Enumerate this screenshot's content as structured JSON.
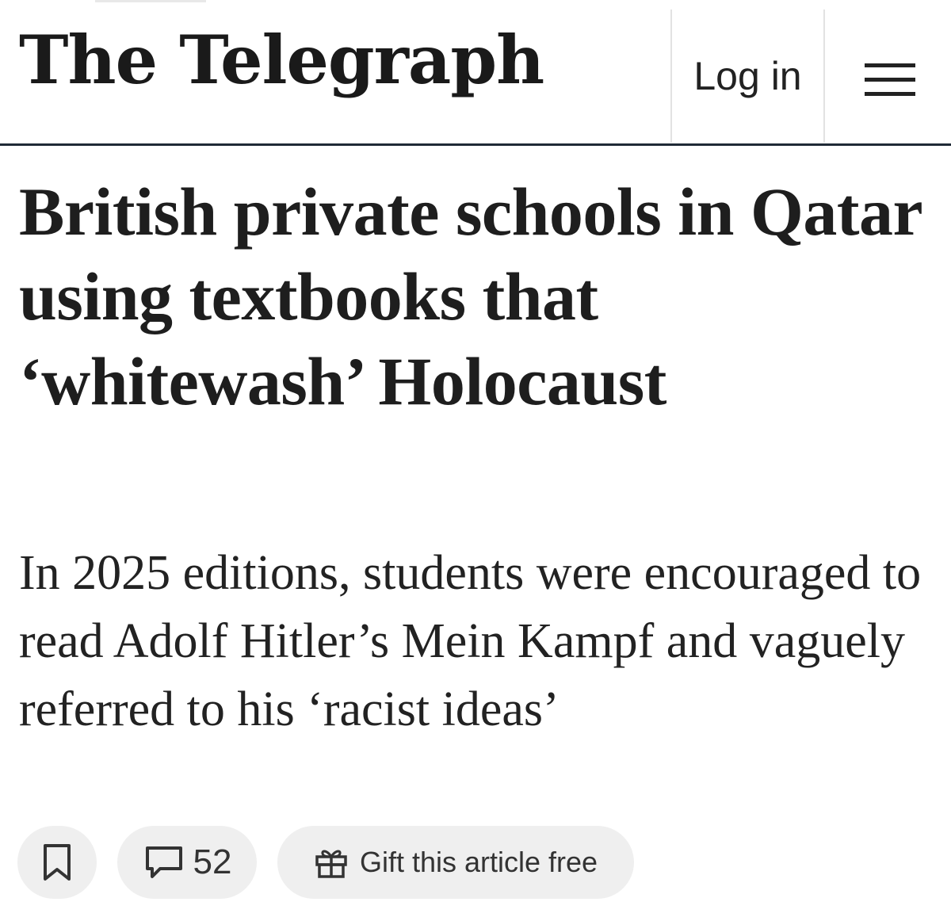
{
  "header": {
    "masthead": "The Telegraph",
    "login_label": "Log in",
    "menu_icon": "hamburger-menu-icon"
  },
  "article": {
    "headline": "British private schools in Qatar using textbooks that ‘whitewash’ Holocaust",
    "standfirst": "In 2025 editions, students were encouraged to read Adolf Hitler’s Mein Kampf and vaguely referred to his ‘racist ideas’"
  },
  "actions": {
    "bookmark_icon": "bookmark-icon",
    "comment_icon": "comment-icon",
    "comments_count": "52",
    "gift_icon": "gift-icon",
    "gift_label": "Gift this article free"
  },
  "colors": {
    "header_rule": "#1f2a36",
    "pill_bg": "#efefef",
    "text": "#222222"
  }
}
